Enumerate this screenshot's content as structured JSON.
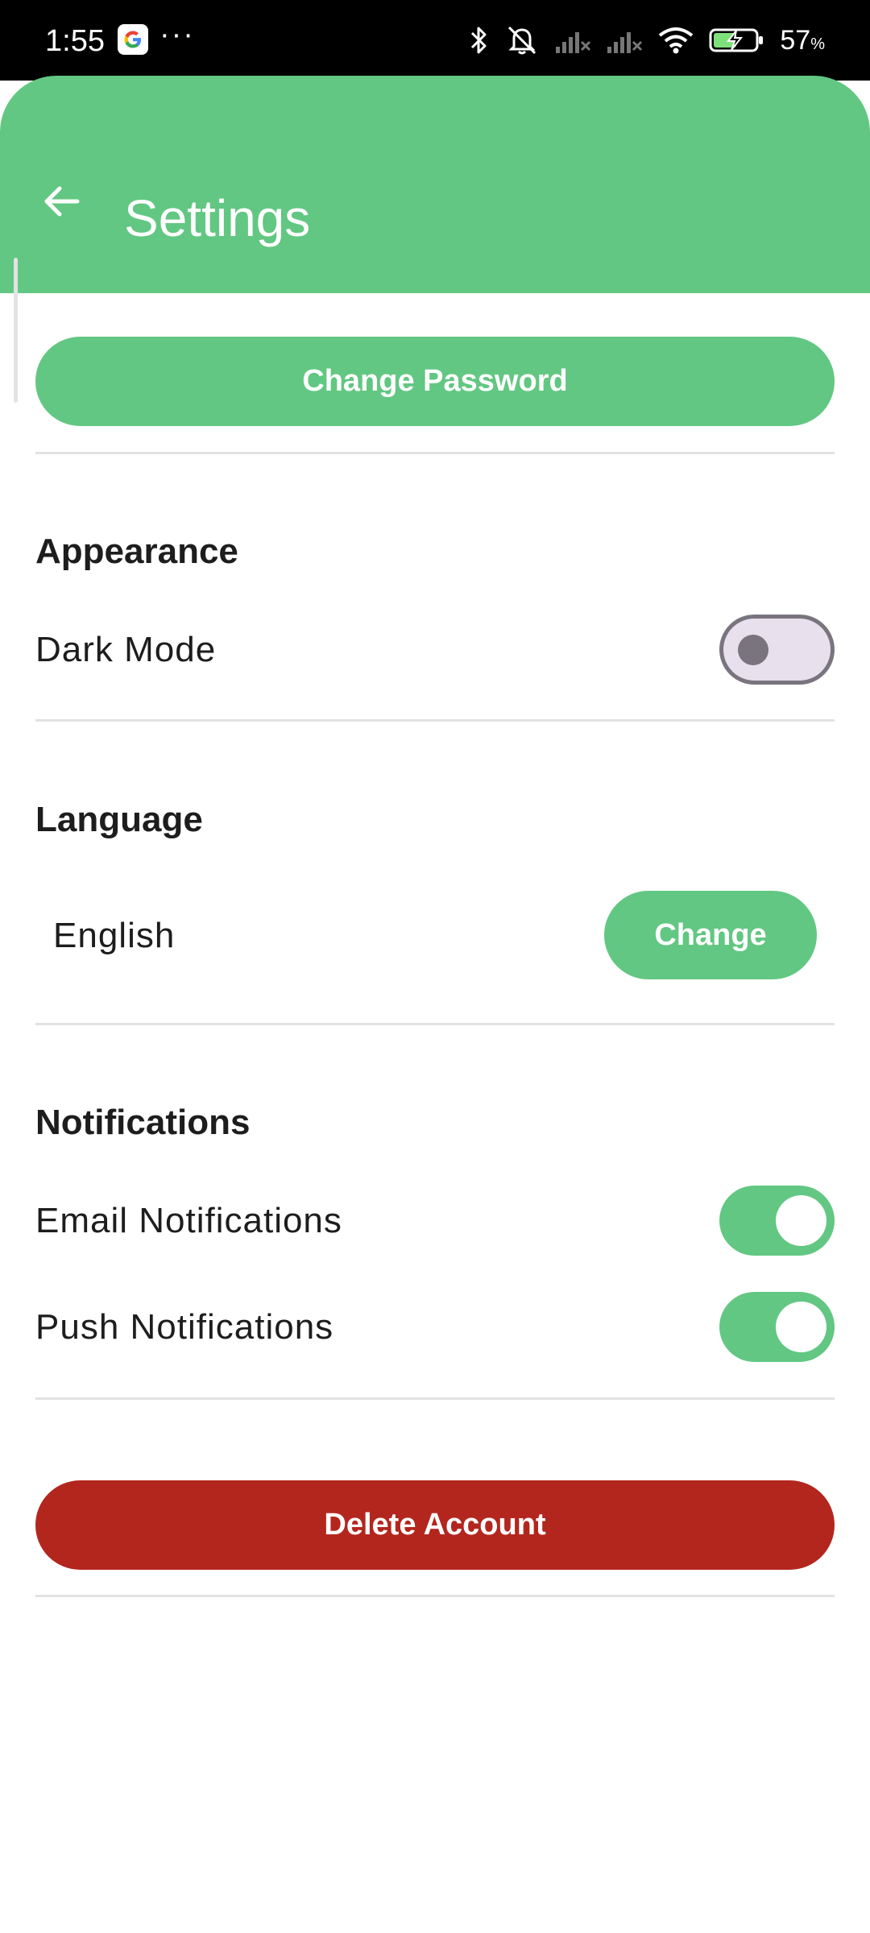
{
  "colors": {
    "accent": "#62C782",
    "danger": "#B3261E",
    "toggle_off_track": "#E8E0EC",
    "toggle_off_outline": "#79747E"
  },
  "status_bar": {
    "time": "1:55",
    "notification_icons": [
      "google-icon",
      "more-dots-icon"
    ],
    "system_icons": [
      "bluetooth-icon",
      "silent-icon",
      "signal-icon",
      "signal-icon",
      "wifi-icon",
      "battery-charging-icon"
    ],
    "battery_percent": "57",
    "battery_unit": "%"
  },
  "header": {
    "back_icon": "arrow-left-icon",
    "title": "Settings"
  },
  "account": {
    "change_password_label": "Change Password"
  },
  "appearance": {
    "heading": "Appearance",
    "dark_mode_label": "Dark Mode",
    "dark_mode_enabled": false
  },
  "language": {
    "heading": "Language",
    "current": "English",
    "change_label": "Change"
  },
  "notifications": {
    "heading": "Notifications",
    "email_label": "Email Notifications",
    "email_enabled": true,
    "push_label": "Push Notifications",
    "push_enabled": true
  },
  "danger_zone": {
    "delete_account_label": "Delete Account"
  }
}
